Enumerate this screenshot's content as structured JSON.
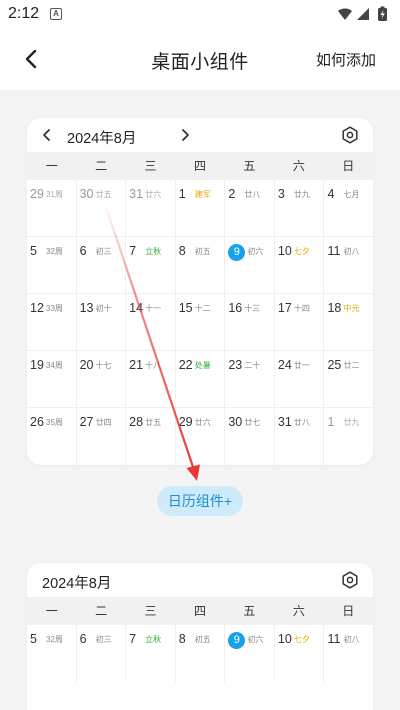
{
  "status_bar": {
    "time": "2:12",
    "notification_glyph": "A",
    "icons": [
      "wifi-icon",
      "signal-icon",
      "battery-charging-icon"
    ]
  },
  "header": {
    "title": "桌面小组件",
    "action_label": "如何添加",
    "back_icon": "back-chevron-icon"
  },
  "colors": {
    "accent": "#1aa1e6",
    "solar_term_green": "#2eaa3a",
    "festival_yellow": "#e9a700",
    "arrow_red": "#e53935",
    "chip_bg": "#cfeaf8"
  },
  "weekdays": [
    "一",
    "二",
    "三",
    "四",
    "五",
    "六",
    "日"
  ],
  "widget_large": {
    "month_label": "2024年8月",
    "weeks": [
      [
        {
          "d": "29",
          "s": "31周",
          "muted": true
        },
        {
          "d": "30",
          "s": "廿五",
          "muted": true
        },
        {
          "d": "31",
          "s": "廿六",
          "muted": true
        },
        {
          "d": "1",
          "s": "建军",
          "c": "yellow"
        },
        {
          "d": "2",
          "s": "廿八"
        },
        {
          "d": "3",
          "s": "廿九"
        },
        {
          "d": "4",
          "s": "七月"
        }
      ],
      [
        {
          "d": "5",
          "s": "32周"
        },
        {
          "d": "6",
          "s": "初三"
        },
        {
          "d": "7",
          "s": "立秋",
          "c": "green"
        },
        {
          "d": "8",
          "s": "初五"
        },
        {
          "d": "9",
          "s": "初六",
          "today": true
        },
        {
          "d": "10",
          "s": "七夕",
          "c": "yellow"
        },
        {
          "d": "11",
          "s": "初八"
        }
      ],
      [
        {
          "d": "12",
          "s": "33周"
        },
        {
          "d": "13",
          "s": "初十"
        },
        {
          "d": "14",
          "s": "十一"
        },
        {
          "d": "15",
          "s": "十二"
        },
        {
          "d": "16",
          "s": "十三"
        },
        {
          "d": "17",
          "s": "十四"
        },
        {
          "d": "18",
          "s": "中元",
          "c": "yellow"
        }
      ],
      [
        {
          "d": "19",
          "s": "34周"
        },
        {
          "d": "20",
          "s": "十七"
        },
        {
          "d": "21",
          "s": "十八"
        },
        {
          "d": "22",
          "s": "处暑",
          "c": "green"
        },
        {
          "d": "23",
          "s": "二十"
        },
        {
          "d": "24",
          "s": "廿一"
        },
        {
          "d": "25",
          "s": "廿二"
        }
      ],
      [
        {
          "d": "26",
          "s": "35周"
        },
        {
          "d": "27",
          "s": "廿四"
        },
        {
          "d": "28",
          "s": "廿五"
        },
        {
          "d": "29",
          "s": "廿六"
        },
        {
          "d": "30",
          "s": "廿七"
        },
        {
          "d": "31",
          "s": "廿八"
        },
        {
          "d": "1",
          "s": "廿九",
          "muted": true
        }
      ]
    ]
  },
  "add_chip_label": "日历组件+",
  "widget_compact": {
    "month_label": "2024年8月",
    "weeks": [
      [
        {
          "d": "5",
          "s": "32周"
        },
        {
          "d": "6",
          "s": "初三"
        },
        {
          "d": "7",
          "s": "立秋",
          "c": "green"
        },
        {
          "d": "8",
          "s": "初五"
        },
        {
          "d": "9",
          "s": "初六",
          "today": true
        },
        {
          "d": "10",
          "s": "七夕",
          "c": "yellow"
        },
        {
          "d": "11",
          "s": "初八"
        }
      ]
    ]
  }
}
